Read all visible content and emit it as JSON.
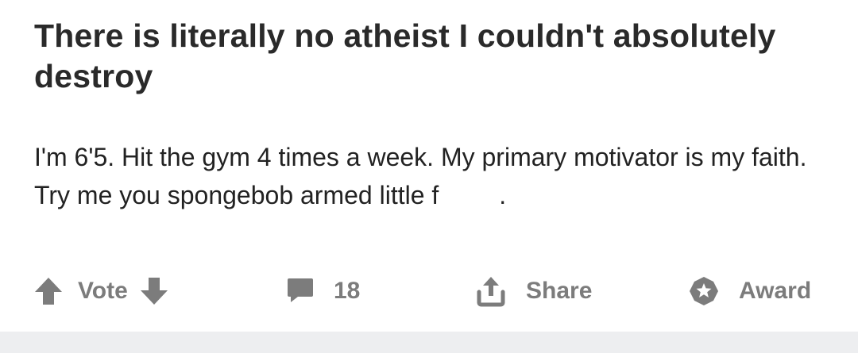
{
  "post": {
    "title": "There is literally no atheist I couldn't absolutely destroy",
    "body_text": "I'm 6'5. Hit the gym 4 times a week. My primary motivator is my faith. Try me you spongebob armed little f",
    "body_end": "."
  },
  "actions": {
    "vote_label": "Vote",
    "comment_count": "18",
    "share_label": "Share",
    "award_label": "Award"
  },
  "icons": {
    "upvote": "arrow-up-icon",
    "downvote": "arrow-down-icon",
    "comments": "comment-bubble-icon",
    "share": "share-upload-icon",
    "award": "award-star-icon"
  },
  "colors": {
    "text": "#222222",
    "action_gray": "#7c7c7c",
    "footer_strip": "#edeef0"
  }
}
